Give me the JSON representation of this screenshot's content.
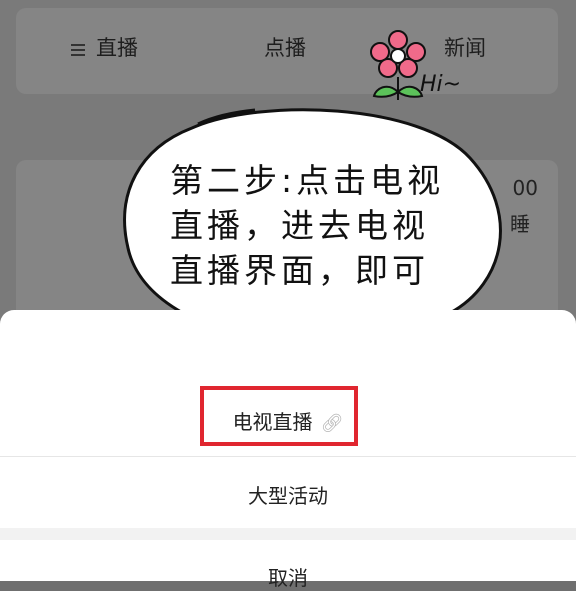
{
  "top_tabs": {
    "live": "直播",
    "vod": "点播",
    "news": "新闻"
  },
  "card": {
    "time_fragment": "00",
    "subtitle_fragment": "睡"
  },
  "bubble": {
    "text": "第二步:点击电视\n直播，进去电视\n直播界面，即可",
    "hi": "Hi~"
  },
  "sheet": {
    "item_tv_live": "电视直播",
    "item_big_event": "大型活动",
    "cancel": "取消"
  },
  "icons": {
    "link": "link-icon",
    "menu": "menu-icon"
  },
  "colors": {
    "highlight": "#e0262f",
    "flower": "#f06a8a"
  }
}
